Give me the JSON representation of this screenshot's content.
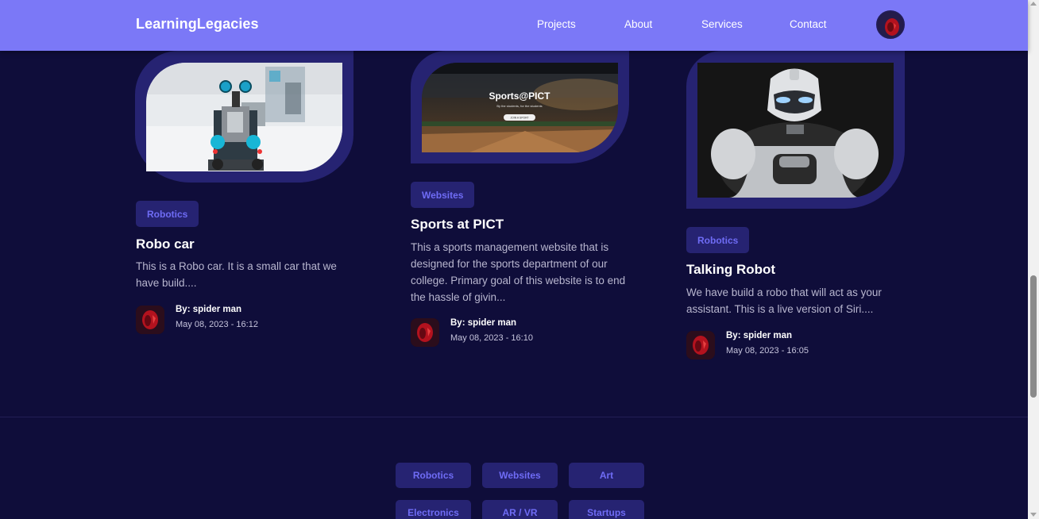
{
  "navbar": {
    "brand": "LearningLegacies",
    "links": [
      "Projects",
      "About",
      "Services",
      "Contact"
    ]
  },
  "cards": [
    {
      "tag": "Robotics",
      "title": "Robo car",
      "description": "This is a Robo car. It is a small car that we have build....",
      "author": "By: spider man",
      "date": "May 08, 2023 - 16:12"
    },
    {
      "tag": "Websites",
      "title": "Sports at PICT",
      "description": "This a sports management website that is designed for the sports department of our college. Primary goal of this website is to end the hassle of givin...",
      "author": "By: spider man",
      "date": "May 08, 2023 - 16:10",
      "thumb_heading": "Sports@PICT",
      "thumb_sub": "By the students, for the students",
      "thumb_button": "JOIN A SPORT"
    },
    {
      "tag": "Robotics",
      "title": "Talking Robot",
      "description": "We have build a robo that will act as your assistant. This is a live version of Siri....",
      "author": "By: spider man",
      "date": "May 08, 2023 - 16:05"
    }
  ],
  "footer_tags": [
    "Robotics",
    "Websites",
    "Art",
    "Electronics",
    "AR / VR",
    "Startups"
  ],
  "colors": {
    "background": "#0f0d3a",
    "navbar": "#7b78f7",
    "tag_bg": "#262372",
    "tag_text": "#6f6cf5"
  }
}
